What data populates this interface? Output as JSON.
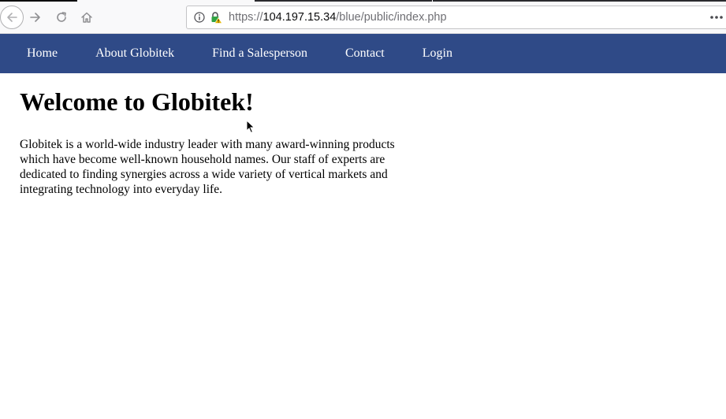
{
  "browser": {
    "url_scheme": "https://",
    "url_host": "104.197.15.34",
    "url_path": "/blue/public/index.php",
    "icons": [
      "back-arrow-icon",
      "forward-arrow-icon",
      "reload-icon",
      "home-icon",
      "info-icon",
      "insecure-lock-icon",
      "overflow-dots-icon"
    ]
  },
  "nav": {
    "items": [
      {
        "label": "Home"
      },
      {
        "label": "About Globitek"
      },
      {
        "label": "Find a Salesperson"
      },
      {
        "label": "Contact"
      },
      {
        "label": "Login"
      }
    ],
    "background": "#2f4a87",
    "text_color": "#ffffff"
  },
  "main": {
    "title": "Welcome to Globitek!",
    "intro": "Globitek is a world-wide industry leader with many award-winning products which have become well-known household names. Our staff of experts are dedicated to finding synergies across a wide variety of vertical markets and integrating technology into everyday life."
  },
  "colors": {
    "lock_warning": "#e8b900",
    "lock_body": "#31a343"
  }
}
